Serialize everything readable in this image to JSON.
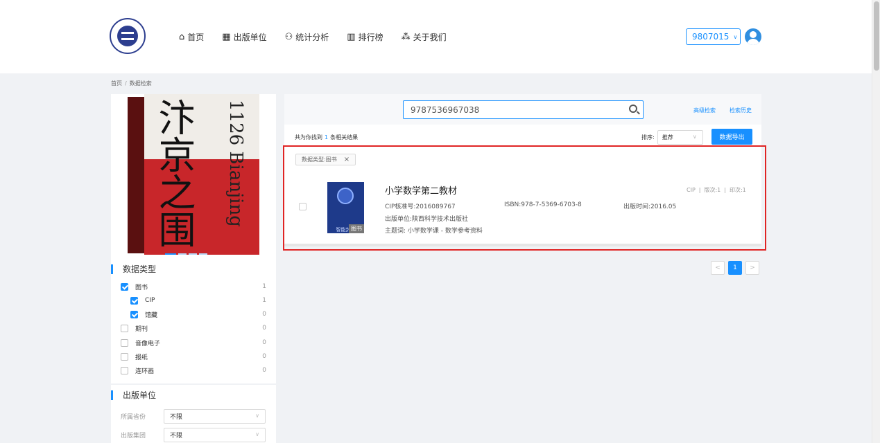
{
  "nav": {
    "items": [
      {
        "label": "首页",
        "icon": "home-icon"
      },
      {
        "label": "出版单位",
        "icon": "publisher-icon"
      },
      {
        "label": "统计分析",
        "icon": "users-icon"
      },
      {
        "label": "排行榜",
        "icon": "ranking-icon"
      },
      {
        "label": "关于我们",
        "icon": "about-icon"
      }
    ]
  },
  "user": {
    "account": "9807015"
  },
  "breadcrumb": {
    "home": "首页",
    "sep": "/",
    "current": "数据检索"
  },
  "book_cover": {
    "title_cn": "汴京之围",
    "title_latin": "1126 Bianjing"
  },
  "facets": {
    "title": "数据类型",
    "items": [
      {
        "label": "图书",
        "count": "1",
        "checked": true
      },
      {
        "label": "CIP",
        "count": "1",
        "checked": true
      },
      {
        "label": "馆藏",
        "count": "0",
        "checked": true
      },
      {
        "label": "期刊",
        "count": "0",
        "checked": false
      },
      {
        "label": "音像电子",
        "count": "0",
        "checked": false
      },
      {
        "label": "报纸",
        "count": "0",
        "checked": false
      },
      {
        "label": "连环画",
        "count": "0",
        "checked": false
      }
    ]
  },
  "publisher_facet": {
    "title": "出版单位",
    "province_label": "所属省份",
    "province_value": "不限",
    "group_label": "出版集团",
    "group_value": "不限"
  },
  "search": {
    "query": "9787536967038",
    "advanced": "高级检索",
    "history": "检索历史"
  },
  "results": {
    "summary_prefix": "共为你找到",
    "count": "1",
    "summary_suffix": "条相关结果",
    "sort_label": "排序:",
    "sort_value": "推荐",
    "export": "数据导出",
    "type_tag": "数据类型:图书",
    "type_tag_close": "×"
  },
  "item": {
    "title": "小学数学第二教材",
    "meta_cip": "CIP",
    "meta_edition": "版次:1",
    "meta_print": "印次:1",
    "cip_no": "CIP核准号:2016089767",
    "isbn": "ISBN:978-7-5369-6703-8",
    "pub_date": "出版时间:2016.05",
    "publisher": "出版单位:陕西科学技术出版社",
    "subject": "主题词: 小学数学课 - 数学参考资料",
    "thumb_label": "智能封面",
    "thumb_badge": "图书"
  },
  "pager": {
    "prev": "<",
    "current": "1",
    "next": ">"
  },
  "colors": {
    "accent": "#1890ff",
    "highlight": "#e02424"
  }
}
